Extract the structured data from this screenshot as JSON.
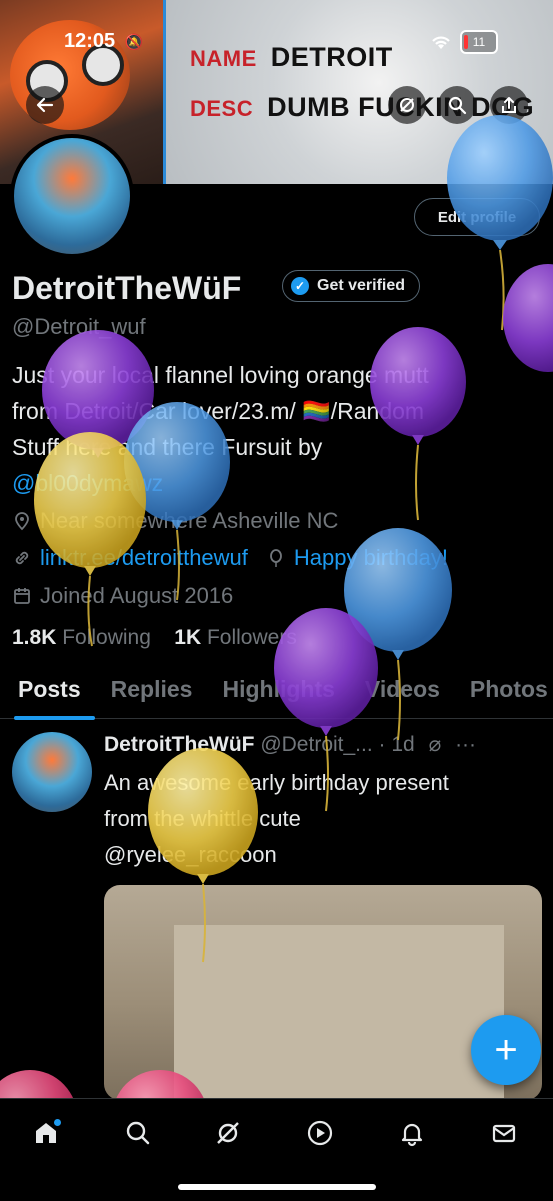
{
  "status": {
    "time": "12:05",
    "battery": "11"
  },
  "banner": {
    "name_key": "NAME",
    "name_val": "DETROIT",
    "desc_key": "DESC",
    "desc_val": "DUMB FUCKIN DOG"
  },
  "profile": {
    "edit_label": "Edit profile",
    "display_name": "DetroitTheWüF",
    "verify_label": "Get verified",
    "handle": "@Detroit_wuf",
    "bio_line1": "Just your local flannel loving orange mutt",
    "bio_line2": "from Detroit/Car lover/23.m/ 🏳️‍🌈/Random",
    "bio_line3": "Stuff here and there Fursuit by",
    "bio_mention": "@bl00dymawz",
    "location": "Near somewhere Asheville NC",
    "website": "linktr.ee/detroitthewuf",
    "birthday": "Happy birthday!",
    "joined": "Joined August 2016",
    "following_count": "1.8K",
    "following_label": "Following",
    "followers_count": "1K",
    "followers_label": "Followers"
  },
  "tabs": [
    "Posts",
    "Replies",
    "Highlights",
    "Videos",
    "Photos"
  ],
  "post": {
    "name": "DetroitTheWüF",
    "handle": "@Detroit_...",
    "time": "· 1d",
    "text_line1": "An awesome early birthday present",
    "text_line2": "from the whittle cute",
    "mention": "@ryelee_raccoon"
  },
  "icons": {
    "back": "back-arrow-icon",
    "grok": "grok-icon",
    "search": "search-icon",
    "share": "share-icon",
    "location": "location-pin-icon",
    "link": "link-icon",
    "balloon": "balloon-icon",
    "calendar": "calendar-icon",
    "compose": "plus-icon",
    "nav": [
      "home-icon",
      "search-icon",
      "grok-icon",
      "play-icon",
      "bell-icon",
      "mail-icon"
    ]
  },
  "colors": {
    "accent": "#1d9bf0",
    "background": "#000000",
    "muted": "#71767b"
  }
}
